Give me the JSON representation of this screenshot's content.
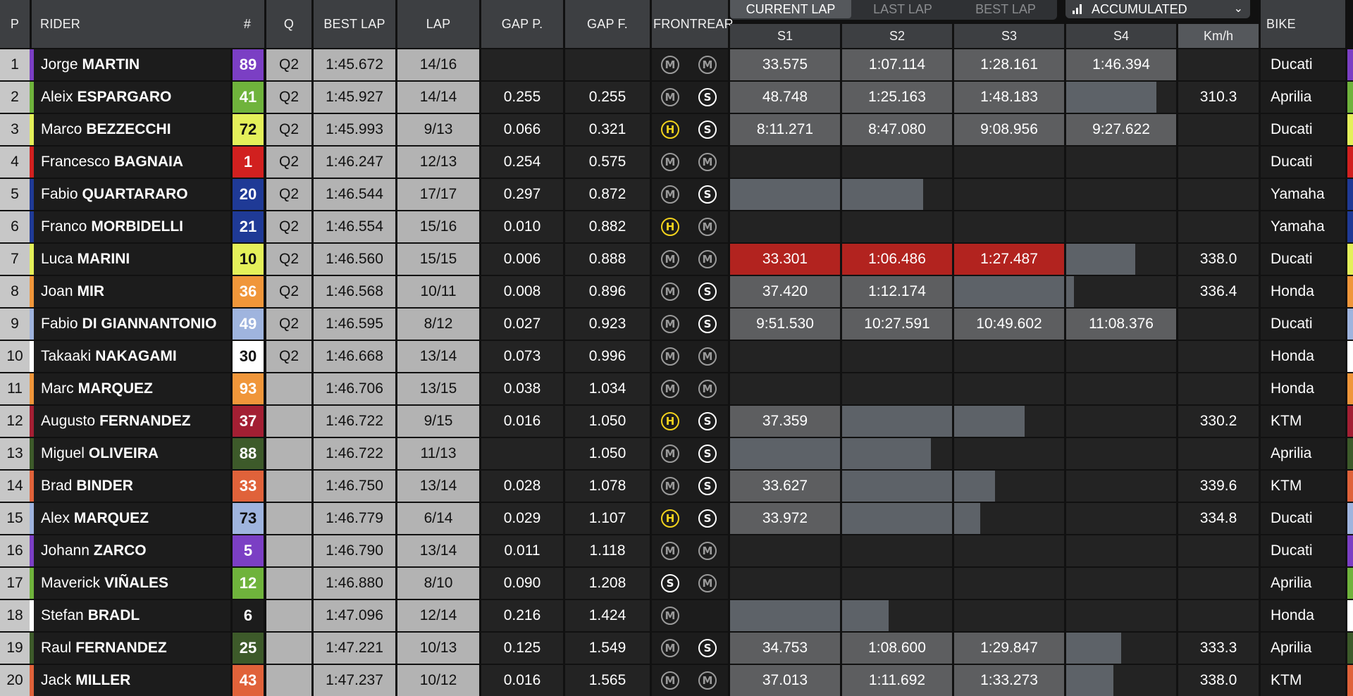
{
  "header": {
    "p": "P",
    "rider": "RIDER",
    "num": "#",
    "q": "Q",
    "best_lap": "BEST LAP",
    "lap": "LAP",
    "gap_p": "GAP P.",
    "gap_f": "GAP F.",
    "front": "FRONT",
    "rear": "REAR",
    "bike": "BIKE",
    "tabs": [
      "CURRENT LAP",
      "LAST LAP",
      "BEST LAP"
    ],
    "active_tab": "CURRENT LAP",
    "mode_select": "ACCUMULATED",
    "sectors": [
      "S1",
      "S2",
      "S3",
      "S4"
    ],
    "kmh": "Km/h"
  },
  "icons": {
    "mode": "bar-chart-icon",
    "dropdown": "chevron-down-icon",
    "tyre": "tyre-compound-icon"
  },
  "tyre_colors": {
    "M": "#9a9a9a",
    "S": "#ffffff",
    "H": "#f2d21c"
  },
  "rows": [
    {
      "pos": "1",
      "first": "Jorge",
      "last": "MARTIN",
      "num": "89",
      "num_bg": "#7b3fc4",
      "num_fg": "#ffffff",
      "q": "Q2",
      "best": "1:45.672",
      "lap": "14/16",
      "gap_p": "",
      "gap_f": "",
      "front": "M",
      "rear": "M",
      "sectors": [
        {
          "t": "33.575",
          "s": "grey",
          "f": 1
        },
        {
          "t": "1:07.114",
          "s": "grey",
          "f": 1
        },
        {
          "t": "1:28.161",
          "s": "grey",
          "f": 1
        },
        {
          "t": "1:46.394",
          "s": "grey",
          "f": 1
        }
      ],
      "kmh": "",
      "bike": "Ducati",
      "stripe": "#7b3fc4"
    },
    {
      "pos": "2",
      "first": "Aleix",
      "last": "ESPARGARO",
      "num": "41",
      "num_bg": "#6fb33c",
      "num_fg": "#ffffff",
      "q": "Q2",
      "best": "1:45.927",
      "lap": "14/14",
      "gap_p": "0.255",
      "gap_f": "0.255",
      "front": "M",
      "rear": "S",
      "sectors": [
        {
          "t": "48.748",
          "s": "grey",
          "f": 1
        },
        {
          "t": "1:25.163",
          "s": "grey",
          "f": 1
        },
        {
          "t": "1:48.183",
          "s": "grey",
          "f": 1
        },
        {
          "t": "",
          "s": "bar",
          "f": 0.82
        }
      ],
      "kmh": "310.3",
      "bike": "Aprilia",
      "stripe": "#6fb33c"
    },
    {
      "pos": "3",
      "first": "Marco",
      "last": "BEZZECCHI",
      "num": "72",
      "num_bg": "#e4f05a",
      "num_fg": "#111111",
      "q": "Q2",
      "best": "1:45.993",
      "lap": "9/13",
      "gap_p": "0.066",
      "gap_f": "0.321",
      "front": "H",
      "rear": "S",
      "sectors": [
        {
          "t": "8:11.271",
          "s": "grey",
          "f": 1
        },
        {
          "t": "8:47.080",
          "s": "grey",
          "f": 1
        },
        {
          "t": "9:08.956",
          "s": "grey",
          "f": 1
        },
        {
          "t": "9:27.622",
          "s": "grey",
          "f": 1
        }
      ],
      "kmh": "",
      "bike": "Ducati",
      "stripe": "#e4f05a"
    },
    {
      "pos": "4",
      "first": "Francesco",
      "last": "BAGNAIA",
      "num": "1",
      "num_bg": "#d1201f",
      "num_fg": "#ffffff",
      "q": "Q2",
      "best": "1:46.247",
      "lap": "12/13",
      "gap_p": "0.254",
      "gap_f": "0.575",
      "front": "M",
      "rear": "M",
      "sectors": [
        {
          "t": "",
          "s": "empty",
          "f": 0
        },
        {
          "t": "",
          "s": "empty",
          "f": 0
        },
        {
          "t": "",
          "s": "empty",
          "f": 0
        },
        {
          "t": "",
          "s": "empty",
          "f": 0
        }
      ],
      "kmh": "",
      "bike": "Ducati",
      "stripe": "#d1201f"
    },
    {
      "pos": "5",
      "first": "Fabio",
      "last": "QUARTARARO",
      "num": "20",
      "num_bg": "#1f3a96",
      "num_fg": "#ffffff",
      "q": "Q2",
      "best": "1:46.544",
      "lap": "17/17",
      "gap_p": "0.297",
      "gap_f": "0.872",
      "front": "M",
      "rear": "S",
      "sectors": [
        {
          "t": "",
          "s": "bar",
          "f": 1
        },
        {
          "t": "",
          "s": "bar",
          "f": 0.74
        },
        {
          "t": "",
          "s": "empty",
          "f": 0
        },
        {
          "t": "",
          "s": "empty",
          "f": 0
        }
      ],
      "kmh": "",
      "bike": "Yamaha",
      "stripe": "#1f3a96"
    },
    {
      "pos": "6",
      "first": "Franco",
      "last": "MORBIDELLI",
      "num": "21",
      "num_bg": "#1f3a96",
      "num_fg": "#ffffff",
      "q": "Q2",
      "best": "1:46.554",
      "lap": "15/16",
      "gap_p": "0.010",
      "gap_f": "0.882",
      "front": "H",
      "rear": "M",
      "sectors": [
        {
          "t": "",
          "s": "empty",
          "f": 0
        },
        {
          "t": "",
          "s": "empty",
          "f": 0
        },
        {
          "t": "",
          "s": "empty",
          "f": 0
        },
        {
          "t": "",
          "s": "empty",
          "f": 0
        }
      ],
      "kmh": "",
      "bike": "Yamaha",
      "stripe": "#1f3a96"
    },
    {
      "pos": "7",
      "first": "Luca",
      "last": "MARINI",
      "num": "10",
      "num_bg": "#e4f05a",
      "num_fg": "#111111",
      "q": "Q2",
      "best": "1:46.560",
      "lap": "15/15",
      "gap_p": "0.006",
      "gap_f": "0.888",
      "front": "M",
      "rear": "M",
      "sectors": [
        {
          "t": "33.301",
          "s": "red",
          "f": 1
        },
        {
          "t": "1:06.486",
          "s": "red",
          "f": 1
        },
        {
          "t": "1:27.487",
          "s": "red",
          "f": 1
        },
        {
          "t": "",
          "s": "bar",
          "f": 0.63
        }
      ],
      "kmh": "338.0",
      "bike": "Ducati",
      "stripe": "#e4f05a"
    },
    {
      "pos": "8",
      "first": "Joan",
      "last": "MIR",
      "num": "36",
      "num_bg": "#f0963a",
      "num_fg": "#ffffff",
      "q": "Q2",
      "best": "1:46.568",
      "lap": "10/11",
      "gap_p": "0.008",
      "gap_f": "0.896",
      "front": "M",
      "rear": "S",
      "sectors": [
        {
          "t": "37.420",
          "s": "grey",
          "f": 1
        },
        {
          "t": "1:12.174",
          "s": "grey",
          "f": 1
        },
        {
          "t": "",
          "s": "bar",
          "f": 1
        },
        {
          "t": "",
          "s": "bar",
          "f": 0.07
        }
      ],
      "kmh": "336.4",
      "bike": "Honda",
      "stripe": "#f0963a"
    },
    {
      "pos": "9",
      "first": "Fabio",
      "last": "DI GIANNANTONIO",
      "num": "49",
      "num_bg": "#9fb4de",
      "num_fg": "#ffffff",
      "q": "Q2",
      "best": "1:46.595",
      "lap": "8/12",
      "gap_p": "0.027",
      "gap_f": "0.923",
      "front": "M",
      "rear": "S",
      "sectors": [
        {
          "t": "9:51.530",
          "s": "grey",
          "f": 1
        },
        {
          "t": "10:27.591",
          "s": "grey",
          "f": 1
        },
        {
          "t": "10:49.602",
          "s": "grey",
          "f": 1
        },
        {
          "t": "11:08.376",
          "s": "grey",
          "f": 1
        }
      ],
      "kmh": "",
      "bike": "Ducati",
      "stripe": "#9fb4de"
    },
    {
      "pos": "10",
      "first": "Takaaki",
      "last": "NAKAGAMI",
      "num": "30",
      "num_bg": "#ffffff",
      "num_fg": "#111111",
      "q": "Q2",
      "best": "1:46.668",
      "lap": "13/14",
      "gap_p": "0.073",
      "gap_f": "0.996",
      "front": "M",
      "rear": "M",
      "sectors": [
        {
          "t": "",
          "s": "empty",
          "f": 0
        },
        {
          "t": "",
          "s": "empty",
          "f": 0
        },
        {
          "t": "",
          "s": "empty",
          "f": 0
        },
        {
          "t": "",
          "s": "empty",
          "f": 0
        }
      ],
      "kmh": "",
      "bike": "Honda",
      "stripe": "#ffffff"
    },
    {
      "pos": "11",
      "first": "Marc",
      "last": "MARQUEZ",
      "num": "93",
      "num_bg": "#f0963a",
      "num_fg": "#ffffff",
      "q": "",
      "best": "1:46.706",
      "lap": "13/15",
      "gap_p": "0.038",
      "gap_f": "1.034",
      "front": "M",
      "rear": "M",
      "sectors": [
        {
          "t": "",
          "s": "empty",
          "f": 0
        },
        {
          "t": "",
          "s": "empty",
          "f": 0
        },
        {
          "t": "",
          "s": "empty",
          "f": 0
        },
        {
          "t": "",
          "s": "empty",
          "f": 0
        }
      ],
      "kmh": "",
      "bike": "Honda",
      "stripe": "#f0963a"
    },
    {
      "pos": "12",
      "first": "Augusto",
      "last": "FERNANDEZ",
      "num": "37",
      "num_bg": "#a31f33",
      "num_fg": "#ffffff",
      "q": "",
      "best": "1:46.722",
      "lap": "9/15",
      "gap_p": "0.016",
      "gap_f": "1.050",
      "front": "H",
      "rear": "S",
      "sectors": [
        {
          "t": "37.359",
          "s": "grey",
          "f": 1
        },
        {
          "t": "",
          "s": "bar",
          "f": 1
        },
        {
          "t": "",
          "s": "bar",
          "f": 0.64
        },
        {
          "t": "",
          "s": "empty",
          "f": 0
        }
      ],
      "kmh": "330.2",
      "bike": "KTM",
      "stripe": "#a31f33"
    },
    {
      "pos": "13",
      "first": "Miguel",
      "last": "OLIVEIRA",
      "num": "88",
      "num_bg": "#3d5a2a",
      "num_fg": "#ffffff",
      "q": "",
      "best": "1:46.722",
      "lap": "11/13",
      "gap_p": "",
      "gap_f": "1.050",
      "front": "M",
      "rear": "S",
      "sectors": [
        {
          "t": "",
          "s": "bar",
          "f": 1
        },
        {
          "t": "",
          "s": "bar",
          "f": 0.81
        },
        {
          "t": "",
          "s": "empty",
          "f": 0
        },
        {
          "t": "",
          "s": "empty",
          "f": 0
        }
      ],
      "kmh": "",
      "bike": "Aprilia",
      "stripe": "#3d5a2a"
    },
    {
      "pos": "14",
      "first": "Brad",
      "last": "BINDER",
      "num": "33",
      "num_bg": "#e0623a",
      "num_fg": "#ffffff",
      "q": "",
      "best": "1:46.750",
      "lap": "13/14",
      "gap_p": "0.028",
      "gap_f": "1.078",
      "front": "M",
      "rear": "S",
      "sectors": [
        {
          "t": "33.627",
          "s": "grey",
          "f": 1
        },
        {
          "t": "",
          "s": "bar",
          "f": 1
        },
        {
          "t": "",
          "s": "bar",
          "f": 0.37
        },
        {
          "t": "",
          "s": "empty",
          "f": 0
        }
      ],
      "kmh": "339.6",
      "bike": "KTM",
      "stripe": "#e0623a"
    },
    {
      "pos": "15",
      "first": "Alex",
      "last": "MARQUEZ",
      "num": "73",
      "num_bg": "#9fb4de",
      "num_fg": "#111111",
      "q": "",
      "best": "1:46.779",
      "lap": "6/14",
      "gap_p": "0.029",
      "gap_f": "1.107",
      "front": "H",
      "rear": "S",
      "sectors": [
        {
          "t": "33.972",
          "s": "grey",
          "f": 1
        },
        {
          "t": "",
          "s": "bar",
          "f": 1
        },
        {
          "t": "",
          "s": "bar",
          "f": 0.24
        },
        {
          "t": "",
          "s": "empty",
          "f": 0
        }
      ],
      "kmh": "334.8",
      "bike": "Ducati",
      "stripe": "#9fb4de"
    },
    {
      "pos": "16",
      "first": "Johann",
      "last": "ZARCO",
      "num": "5",
      "num_bg": "#7b3fc4",
      "num_fg": "#ffffff",
      "q": "",
      "best": "1:46.790",
      "lap": "13/14",
      "gap_p": "0.011",
      "gap_f": "1.118",
      "front": "M",
      "rear": "M",
      "sectors": [
        {
          "t": "",
          "s": "empty",
          "f": 0
        },
        {
          "t": "",
          "s": "empty",
          "f": 0
        },
        {
          "t": "",
          "s": "empty",
          "f": 0
        },
        {
          "t": "",
          "s": "empty",
          "f": 0
        }
      ],
      "kmh": "",
      "bike": "Ducati",
      "stripe": "#7b3fc4"
    },
    {
      "pos": "17",
      "first": "Maverick",
      "last": "VIÑALES",
      "num": "12",
      "num_bg": "#6fb33c",
      "num_fg": "#ffffff",
      "q": "",
      "best": "1:46.880",
      "lap": "8/10",
      "gap_p": "0.090",
      "gap_f": "1.208",
      "front": "S",
      "rear": "M",
      "sectors": [
        {
          "t": "",
          "s": "empty",
          "f": 0
        },
        {
          "t": "",
          "s": "empty",
          "f": 0
        },
        {
          "t": "",
          "s": "empty",
          "f": 0
        },
        {
          "t": "",
          "s": "empty",
          "f": 0
        }
      ],
      "kmh": "",
      "bike": "Aprilia",
      "stripe": "#6fb33c"
    },
    {
      "pos": "18",
      "first": "Stefan",
      "last": "BRADL",
      "num": "6",
      "num_bg": "#1c1c1c",
      "num_fg": "#ffffff",
      "q": "",
      "best": "1:47.096",
      "lap": "12/14",
      "gap_p": "0.216",
      "gap_f": "1.424",
      "front": "M",
      "rear": "",
      "sectors": [
        {
          "t": "",
          "s": "bar",
          "f": 1
        },
        {
          "t": "",
          "s": "bar",
          "f": 0.42
        },
        {
          "t": "",
          "s": "empty",
          "f": 0
        },
        {
          "t": "",
          "s": "empty",
          "f": 0
        }
      ],
      "kmh": "",
      "bike": "Honda",
      "stripe": "#ffffff"
    },
    {
      "pos": "19",
      "first": "Raul",
      "last": "FERNANDEZ",
      "num": "25",
      "num_bg": "#3d5a2a",
      "num_fg": "#ffffff",
      "q": "",
      "best": "1:47.221",
      "lap": "10/13",
      "gap_p": "0.125",
      "gap_f": "1.549",
      "front": "M",
      "rear": "S",
      "sectors": [
        {
          "t": "34.753",
          "s": "grey",
          "f": 1
        },
        {
          "t": "1:08.600",
          "s": "grey",
          "f": 1
        },
        {
          "t": "1:29.847",
          "s": "grey",
          "f": 1
        },
        {
          "t": "",
          "s": "bar",
          "f": 0.5
        }
      ],
      "kmh": "333.3",
      "bike": "Aprilia",
      "stripe": "#3d5a2a"
    },
    {
      "pos": "20",
      "first": "Jack",
      "last": "MILLER",
      "num": "43",
      "num_bg": "#e0623a",
      "num_fg": "#ffffff",
      "q": "",
      "best": "1:47.237",
      "lap": "10/12",
      "gap_p": "0.016",
      "gap_f": "1.565",
      "front": "M",
      "rear": "M",
      "sectors": [
        {
          "t": "37.013",
          "s": "grey",
          "f": 1
        },
        {
          "t": "1:11.692",
          "s": "grey",
          "f": 1
        },
        {
          "t": "1:33.273",
          "s": "grey",
          "f": 1
        },
        {
          "t": "",
          "s": "bar",
          "f": 0.43
        }
      ],
      "kmh": "338.0",
      "bike": "KTM",
      "stripe": "#e0623a"
    }
  ]
}
